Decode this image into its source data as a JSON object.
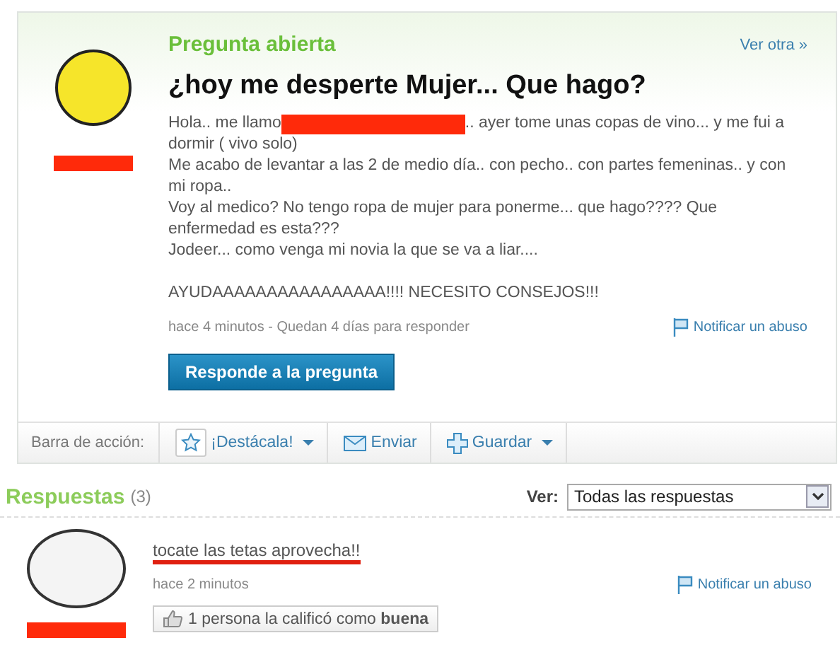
{
  "question": {
    "status": "Pregunta abierta",
    "next_link": "Ver otra »",
    "title": "¿hoy me desperte Mujer... Que hago?",
    "body": [
      [
        [
          "Hola.. me llamo",
          ".. ayer tome unas copas de vino... y me fui a"
        ],
        [
          "dormir ( vivo solo)"
        ],
        [
          "Me acabo de levantar a las 2 de medio día.. con pecho.. con partes femeninas.. y con"
        ],
        [
          "mi ropa.."
        ],
        [
          "Voy al medico? No tengo ropa de mujer para ponerme... que hago???? Que"
        ],
        [
          "enfermedad es esta???"
        ],
        [
          "Jodeer... como venga mi novia la que se va a liar...."
        ]
      ],
      [
        [
          "AYUDAAAAAAAAAAAAAAAA!!!! NECESITO CONSEJOS!!!"
        ]
      ]
    ],
    "meta": "hace 4 minutos - Quedan 4 días para responder",
    "report_link": "Notificar un abuso",
    "answer_button": "Responde a la pregunta"
  },
  "action_bar": {
    "label": "Barra de acción:",
    "items": [
      {
        "kind": "star",
        "label": "¡Destácala!",
        "dropdown": true
      },
      {
        "kind": "mail",
        "label": "Enviar",
        "dropdown": false
      },
      {
        "kind": "plus",
        "label": "Guardar",
        "dropdown": true
      }
    ]
  },
  "answers_section": {
    "title": "Respuestas",
    "count": "(3)",
    "filter_label": "Ver:",
    "filter_value": "Todas las respuestas"
  },
  "answers": [
    {
      "text": "tocate las tetas aprovecha!!",
      "meta": "hace 2 minutos",
      "report_link": "Notificar un abuso",
      "rating_text": "1 persona la calificó como **buena**"
    }
  ]
}
